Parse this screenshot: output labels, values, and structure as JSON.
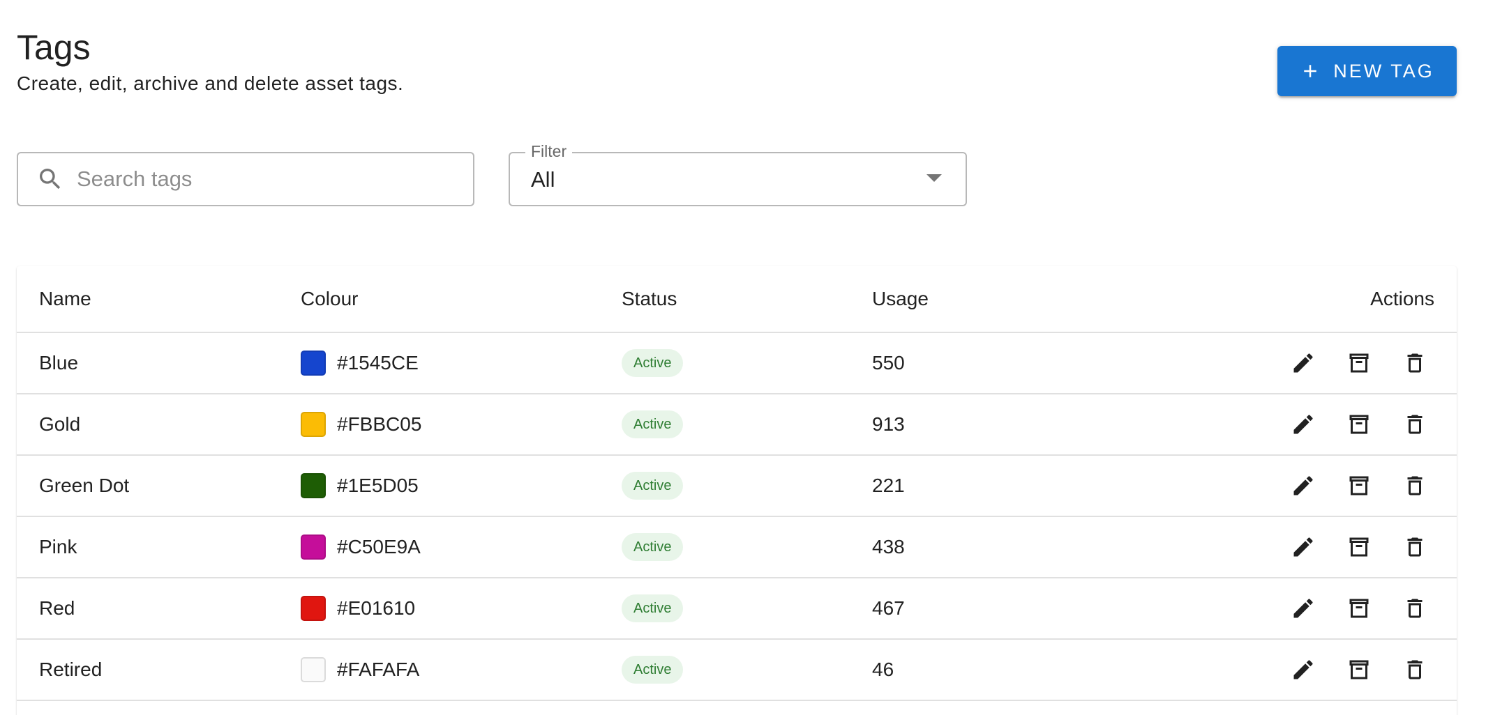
{
  "header": {
    "title": "Tags",
    "subtitle": "Create, edit, archive and delete asset tags.",
    "new_tag_label": "NEW TAG"
  },
  "search": {
    "placeholder": "Search tags",
    "value": ""
  },
  "filter": {
    "label": "Filter",
    "value": "All"
  },
  "table": {
    "columns": {
      "name": "Name",
      "colour": "Colour",
      "status": "Status",
      "usage": "Usage",
      "actions": "Actions"
    },
    "rows": [
      {
        "name": "Blue",
        "colour": "#1545CE",
        "status": "Active",
        "usage": "550"
      },
      {
        "name": "Gold",
        "colour": "#FBBC05",
        "status": "Active",
        "usage": "913"
      },
      {
        "name": "Green Dot",
        "colour": "#1E5D05",
        "status": "Active",
        "usage": "221"
      },
      {
        "name": "Pink",
        "colour": "#C50E9A",
        "status": "Active",
        "usage": "438"
      },
      {
        "name": "Red",
        "colour": "#E01610",
        "status": "Active",
        "usage": "467"
      },
      {
        "name": "Retired",
        "colour": "#FAFAFA",
        "status": "Active",
        "usage": "46"
      }
    ]
  },
  "icons": {
    "new_tag": "plus-icon",
    "search": "search-icon",
    "filter": "arrow-drop-down-icon",
    "edit": "pencil-icon",
    "archive": "archive-icon",
    "delete": "trash-icon"
  },
  "colors": {
    "primary": "#1976d2",
    "status_active_bg": "#e8f5e9",
    "status_active_text": "#2e7d32"
  }
}
